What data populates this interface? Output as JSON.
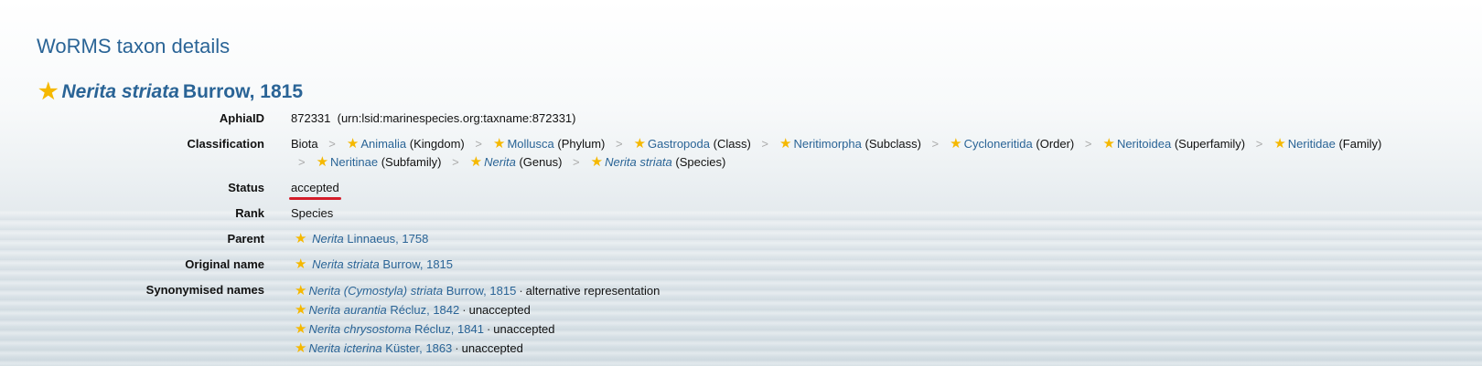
{
  "page_title": "WoRMS taxon details",
  "header": {
    "genus_species": "Nerita striata",
    "authority": "Burrow, 1815"
  },
  "aphia": {
    "label": "AphiaID",
    "id": "872331",
    "lsid": "(urn:lsid:marinespecies.org:taxname:872331)"
  },
  "classification": {
    "label": "Classification",
    "root": "Biota",
    "items": [
      {
        "name": "Animalia",
        "rank": "(Kingdom)",
        "italic": false
      },
      {
        "name": "Mollusca",
        "rank": "(Phylum)",
        "italic": false
      },
      {
        "name": "Gastropoda",
        "rank": "(Class)",
        "italic": false
      },
      {
        "name": "Neritimorpha",
        "rank": "(Subclass)",
        "italic": false
      },
      {
        "name": "Cycloneritida",
        "rank": "(Order)",
        "italic": false
      },
      {
        "name": "Neritoidea",
        "rank": "(Superfamily)",
        "italic": false
      },
      {
        "name": "Neritidae",
        "rank": "(Family)",
        "italic": false
      },
      {
        "name": "Neritinae",
        "rank": "(Subfamily)",
        "italic": false
      },
      {
        "name": "Nerita",
        "rank": "(Genus)",
        "italic": true
      },
      {
        "name": "Nerita striata",
        "rank": "(Species)",
        "italic": true
      }
    ]
  },
  "status": {
    "label": "Status",
    "value": "accepted"
  },
  "rank": {
    "label": "Rank",
    "value": "Species"
  },
  "parent": {
    "label": "Parent",
    "name": "Nerita",
    "authority": "Linnaeus, 1758"
  },
  "original_name": {
    "label": "Original name",
    "name": "Nerita striata",
    "authority": "Burrow, 1815"
  },
  "synonymised": {
    "label": "Synonymised names",
    "items": [
      {
        "name": "Nerita (Cymostyla) striata",
        "authority": "Burrow, 1815",
        "status": "alternative representation"
      },
      {
        "name": "Nerita aurantia",
        "authority": "Récluz, 1842",
        "status": "unaccepted"
      },
      {
        "name": "Nerita chrysostoma",
        "authority": "Récluz, 1841",
        "status": "unaccepted"
      },
      {
        "name": "Nerita icterina",
        "authority": "Küster, 1863",
        "status": "unaccepted"
      }
    ]
  },
  "separator": ">",
  "dot": "·",
  "colors": {
    "link": "#2a6496",
    "star": "#f5b800",
    "highlight": "#d41d2a"
  }
}
